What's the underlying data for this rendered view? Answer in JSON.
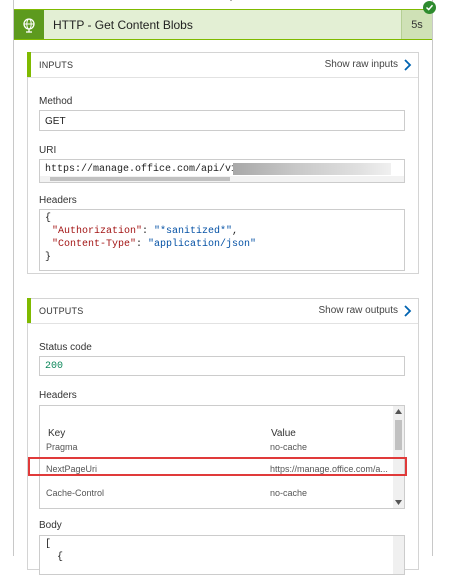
{
  "action": {
    "title": "HTTP - Get Content Blobs",
    "duration": "5s",
    "icon": "globe-icon",
    "status_icon": "checkmark-icon",
    "status_color": "#2e8b2e",
    "accent_color": "#7fba00"
  },
  "inputs": {
    "section_title": "INPUTS",
    "show_raw_label": "Show raw inputs",
    "method_label": "Method",
    "method_value": "GET",
    "uri_label": "URI",
    "uri_value": "https://manage.office.com/api/v1.0/",
    "headers_label": "Headers",
    "headers_lines": [
      {
        "open": "{"
      },
      {
        "key": "\"Authorization\"",
        "sep": ": ",
        "value": "\"*sanitized*\"",
        "end": ","
      },
      {
        "key": "\"Content-Type\"",
        "sep": ": ",
        "value": "\"application/json\"",
        "end": ""
      },
      {
        "close": "}"
      }
    ]
  },
  "outputs": {
    "section_title": "OUTPUTS",
    "show_raw_label": "Show raw outputs",
    "status_code_label": "Status code",
    "status_code_value": "200",
    "headers_label": "Headers",
    "columns": [
      "Key",
      "Value"
    ],
    "rows": [
      {
        "key": "Pragma",
        "value": "no-cache"
      },
      {
        "key": "NextPageUri",
        "value": "https://manage.office.com/a..."
      },
      {
        "key": "Cache-Control",
        "value": "no-cache"
      }
    ],
    "body_label": "Body",
    "body_lines": [
      "[",
      "  {"
    ]
  },
  "annotation": {
    "highlight_color": "#e03a3a"
  }
}
